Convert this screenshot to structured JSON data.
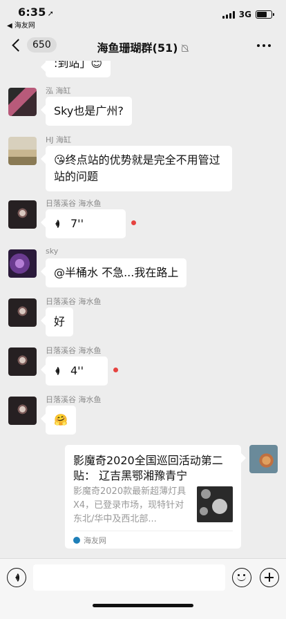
{
  "status_bar": {
    "time": "6:35",
    "location_arrow": "➚",
    "back_to_app": "◀ 海友网",
    "network": "3G",
    "battery_level": 0.7
  },
  "nav": {
    "back_count": "650",
    "title": "海鱼珊瑚群(51)"
  },
  "messages": [
    {
      "type": "text",
      "text": ":到站」😊"
    },
    {
      "type": "text",
      "sender": "泓 海缸",
      "text": "Sky也是广州?"
    },
    {
      "type": "text",
      "sender": "HJ 海缸",
      "text": "😘终点站的优势就是完全不用管过站的问题"
    },
    {
      "type": "voice",
      "sender": "日落溪谷 海水鱼",
      "duration": "7''",
      "unread": true
    },
    {
      "type": "text",
      "sender": "sky",
      "text": "@半桶水 不急...我在路上"
    },
    {
      "type": "text",
      "sender": "日落溪谷 海水鱼",
      "text": "好"
    },
    {
      "type": "voice",
      "sender": "日落溪谷 海水鱼",
      "duration": "4''",
      "unread": true
    },
    {
      "type": "text",
      "sender": "日落溪谷 海水鱼",
      "text": "🤗"
    }
  ],
  "link_card": {
    "title": "影魔奇2020全国巡回活动第二贴： 辽吉黑鄂湘豫青宁",
    "description": "影魔奇2020款最新超薄灯具X4，已登录市场，现特针对东北/华中及西北部...",
    "source": "海友网"
  },
  "colors": {
    "background": "#ededed",
    "bubble": "#ffffff",
    "unread_dot": "#e64340"
  }
}
